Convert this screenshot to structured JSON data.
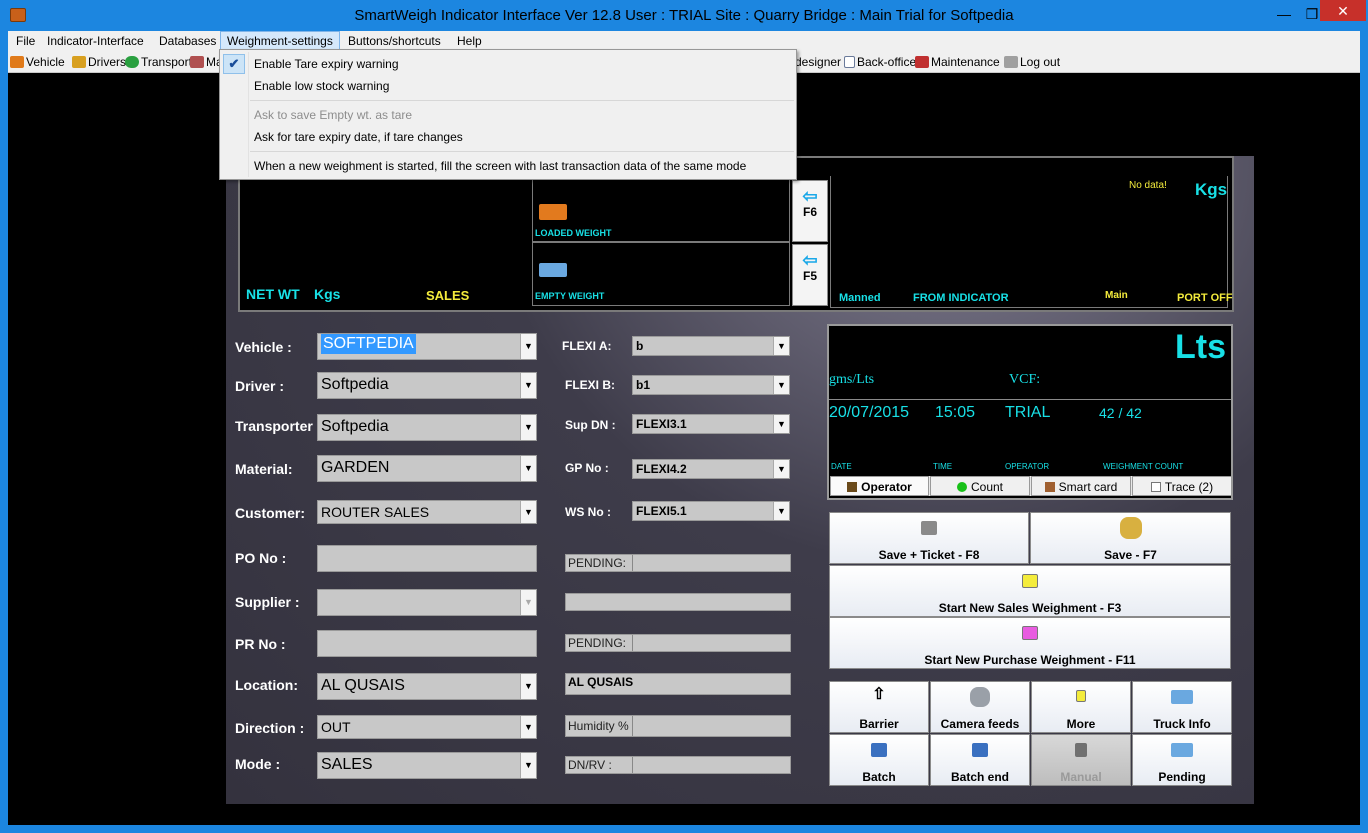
{
  "window": {
    "title": "SmartWeigh Indicator Interface Ver 12.8     User : TRIAL      Site : Quarry     Bridge : Main     Trial for Softpedia",
    "min": "—",
    "max": "❒",
    "close": "✕"
  },
  "menu": [
    {
      "label": "File"
    },
    {
      "label": "Indicator-Interface"
    },
    {
      "label": "Databases"
    },
    {
      "label": "Weighment-settings"
    },
    {
      "label": "Buttons/shortcuts"
    },
    {
      "label": "Help"
    }
  ],
  "toolbar": [
    {
      "label": "Vehicle",
      "color": "#e07a1a"
    },
    {
      "label": "Drivers",
      "color": "#d8a020"
    },
    {
      "label": "Transport",
      "color": "#2aa040"
    },
    {
      "label": "Ma",
      "color": "#b05050"
    },
    {
      "label": "designer",
      "color": "#ffffff"
    },
    {
      "label": "Back-office",
      "color": "#e8eef8"
    },
    {
      "label": "Maintenance",
      "color": "#c03030"
    },
    {
      "label": "Log out",
      "color": "#a0a0a0"
    }
  ],
  "dropdown": {
    "items": [
      {
        "label": "Enable Tare expiry warning",
        "checked": true,
        "disabled": false
      },
      {
        "label": "Enable low stock warning",
        "checked": false,
        "disabled": false
      },
      {
        "label": "Ask to save Empty wt. as tare",
        "checked": false,
        "disabled": true
      },
      {
        "label": "Ask for tare expiry date, if tare changes",
        "checked": false,
        "disabled": false
      },
      {
        "label": "When a new weighment is started, fill the screen with last transaction data of the same mode",
        "checked": false,
        "disabled": false
      }
    ],
    "check_glyph": "✔"
  },
  "display": {
    "net_wt_label": "NET WT",
    "net_wt_unit": "Kgs",
    "mode_label": "SALES",
    "loaded_weight": "LOADED WEIGHT",
    "empty_weight": "EMPTY WEIGHT",
    "f6": "F6",
    "f5": "F5",
    "arrow": "⇦",
    "no_data": "No data!",
    "unit": "Kgs",
    "manned": "Manned",
    "from_indicator": "FROM INDICATOR",
    "bridge": "Main",
    "port": "PORT OFF"
  },
  "form": {
    "vehicle": {
      "label": "Vehicle   :",
      "value": "SOFTPEDIA"
    },
    "driver": {
      "label": "Driver     :",
      "value": "Softpedia"
    },
    "transporter": {
      "label": "Transporter",
      "value": "Softpedia"
    },
    "material": {
      "label": "Material:",
      "value": "GARDEN"
    },
    "customer": {
      "label": "Customer:",
      "value": "ROUTER SALES"
    },
    "po_no": {
      "label": "PO No    :"
    },
    "supplier": {
      "label": "Supplier  :"
    },
    "pr_no": {
      "label": "PR No    :"
    },
    "location": {
      "label": "Location:",
      "value": "AL QUSAIS"
    },
    "direction": {
      "label": "Direction :",
      "value": "OUT"
    },
    "mode": {
      "label": "Mode     :",
      "value": "SALES"
    },
    "dd_glyph": "▼"
  },
  "flexi": {
    "a": {
      "label": "FLEXI A:",
      "value": "b"
    },
    "b": {
      "label": "FLEXI B:",
      "value": "b1"
    },
    "sup_dn": {
      "label": "Sup DN :",
      "value": "FLEXI3.1"
    },
    "gp_no": {
      "label": "GP No  :",
      "value": "FLEXI4.2"
    },
    "ws_no": {
      "label": "WS No  :",
      "value": "FLEXI5.1"
    },
    "pending1": "PENDING:",
    "pending2": "PENDING:",
    "location_text": "AL QUSAIS",
    "humidity": "Humidity %",
    "dn_rv": "DN/RV  :"
  },
  "stock": {
    "unit": "Lts",
    "gms_lts": "gms/Lts",
    "vcf": "VCF:",
    "date": "20/07/2015",
    "time": "15:05",
    "operator": "TRIAL",
    "count": "42 / 42",
    "date_label": "DATE",
    "time_label": "TIME",
    "operator_label": "OPERATOR",
    "count_label": "WEIGHMENT COUNT"
  },
  "tabs": [
    {
      "label": "Operator",
      "color": "#6a4a1a"
    },
    {
      "label": "Count",
      "color": "#18c018"
    },
    {
      "label": "Smart card",
      "color": "#a06030"
    },
    {
      "label": "Trace (2)",
      "color": "#e8e8e8"
    }
  ],
  "actions": {
    "save_ticket": "Save + Ticket - F8",
    "save": "Save - F7",
    "new_sales": "Start New Sales Weighment - F3",
    "new_purchase": "Start New Purchase Weighment - F11",
    "barrier": "Barrier",
    "camera": "Camera feeds",
    "more": "More",
    "truck_info": "Truck Info",
    "batch": "Batch",
    "batch_end": "Batch end",
    "manual": "Manual",
    "pending": "Pending",
    "up_arrow": "⇧"
  }
}
